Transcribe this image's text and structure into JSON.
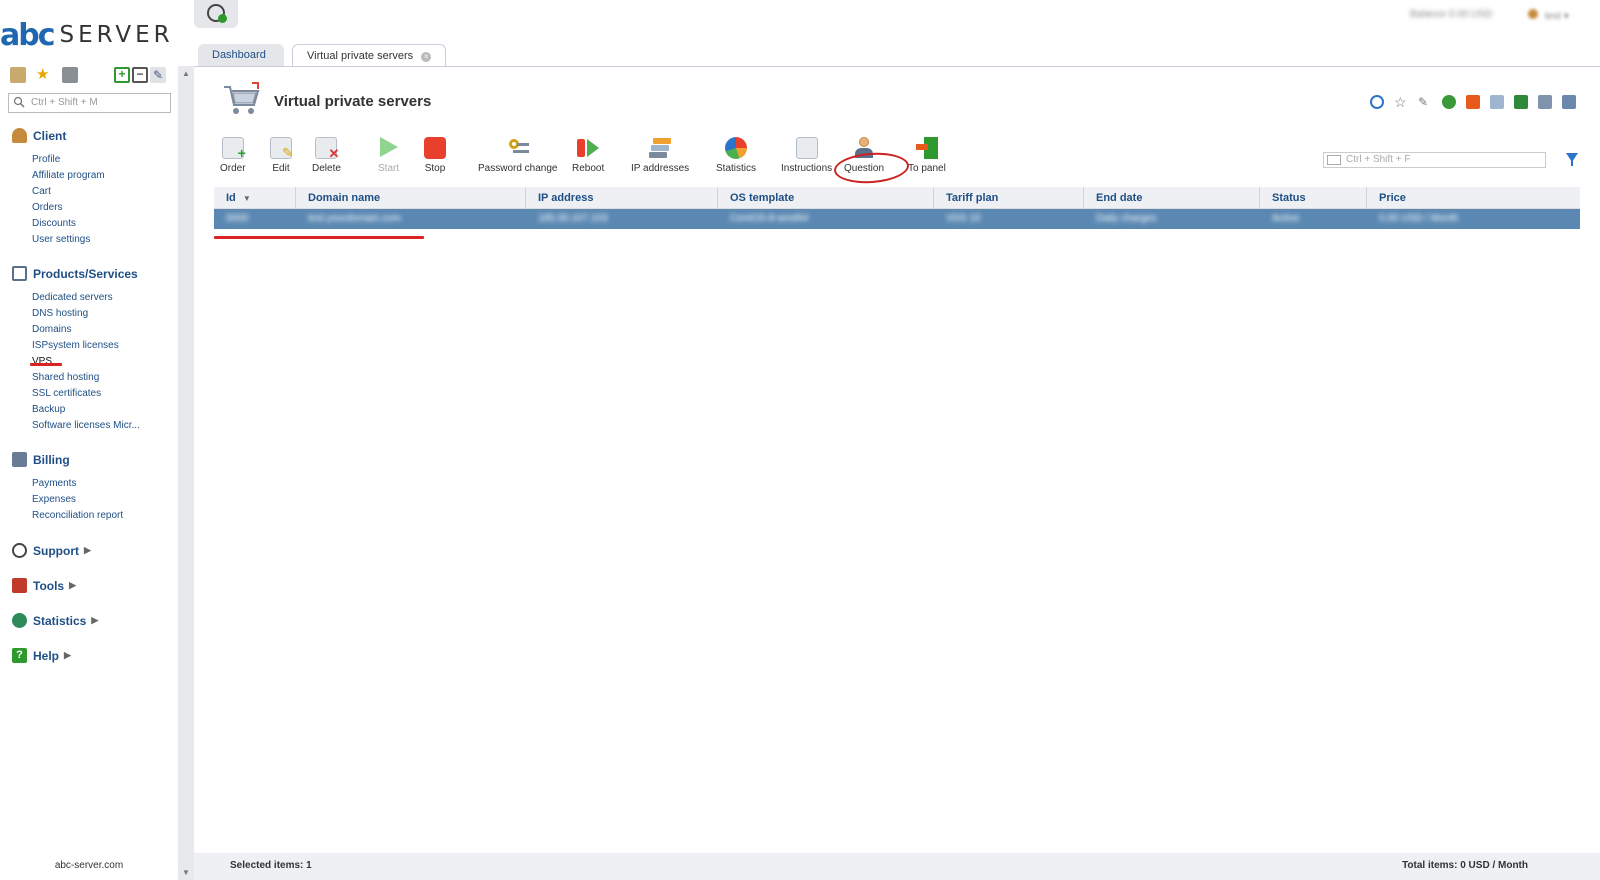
{
  "logo": {
    "mark": "abc",
    "word": "SERVER"
  },
  "sidebar": {
    "search_placeholder": "Ctrl + Shift + M",
    "sections": {
      "client": {
        "label": "Client",
        "items": [
          "Profile",
          "Affiliate program",
          "Cart",
          "Orders",
          "Discounts",
          "User settings"
        ]
      },
      "products": {
        "label": "Products/Services",
        "items": [
          "Dedicated servers",
          "DNS hosting",
          "Domains",
          "ISPsystem licenses",
          "VPS",
          "Shared hosting",
          "SSL certificates",
          "Backup",
          "Software licenses Micr..."
        ]
      },
      "billing": {
        "label": "Billing",
        "items": [
          "Payments",
          "Expenses",
          "Reconciliation report"
        ]
      },
      "support": {
        "label": "Support"
      },
      "tools": {
        "label": "Tools"
      },
      "statistics": {
        "label": "Statistics"
      },
      "help": {
        "label": "Help"
      }
    },
    "footer": "abc-server.com"
  },
  "header": {
    "balance": "Balance 0.00 USD",
    "user": "test"
  },
  "tabs": [
    {
      "label": "Dashboard"
    },
    {
      "label": "Virtual private servers",
      "active": true
    }
  ],
  "page": {
    "title": "Virtual private servers"
  },
  "toolbar": {
    "order": "Order",
    "edit": "Edit",
    "delete": "Delete",
    "start": "Start",
    "stop": "Stop",
    "password_change": "Password change",
    "reboot": "Reboot",
    "ip_addresses": "IP addresses",
    "statistics": "Statistics",
    "instructions": "Instructions",
    "question": "Question",
    "to_panel": "To panel"
  },
  "filter": {
    "placeholder": "Ctrl + Shift + F"
  },
  "table": {
    "headers": [
      "Id",
      "Domain name",
      "IP address",
      "OS template",
      "Tariff plan",
      "End date",
      "Status",
      "Price"
    ],
    "rows": [
      [
        "0000",
        "test.yourdomain.com",
        "185.00.107.103",
        "CentOS-8-amd64",
        "VDS 10",
        "Daily charges",
        "Active",
        "0.00 USD / Month"
      ]
    ]
  },
  "statusbar": {
    "selected": "Selected items: 1",
    "total": "Total items: 0 USD / Month"
  },
  "colors": {
    "accent": "#1f4f85",
    "selected_row": "#5b88b3",
    "annotation": "#dd2222"
  }
}
